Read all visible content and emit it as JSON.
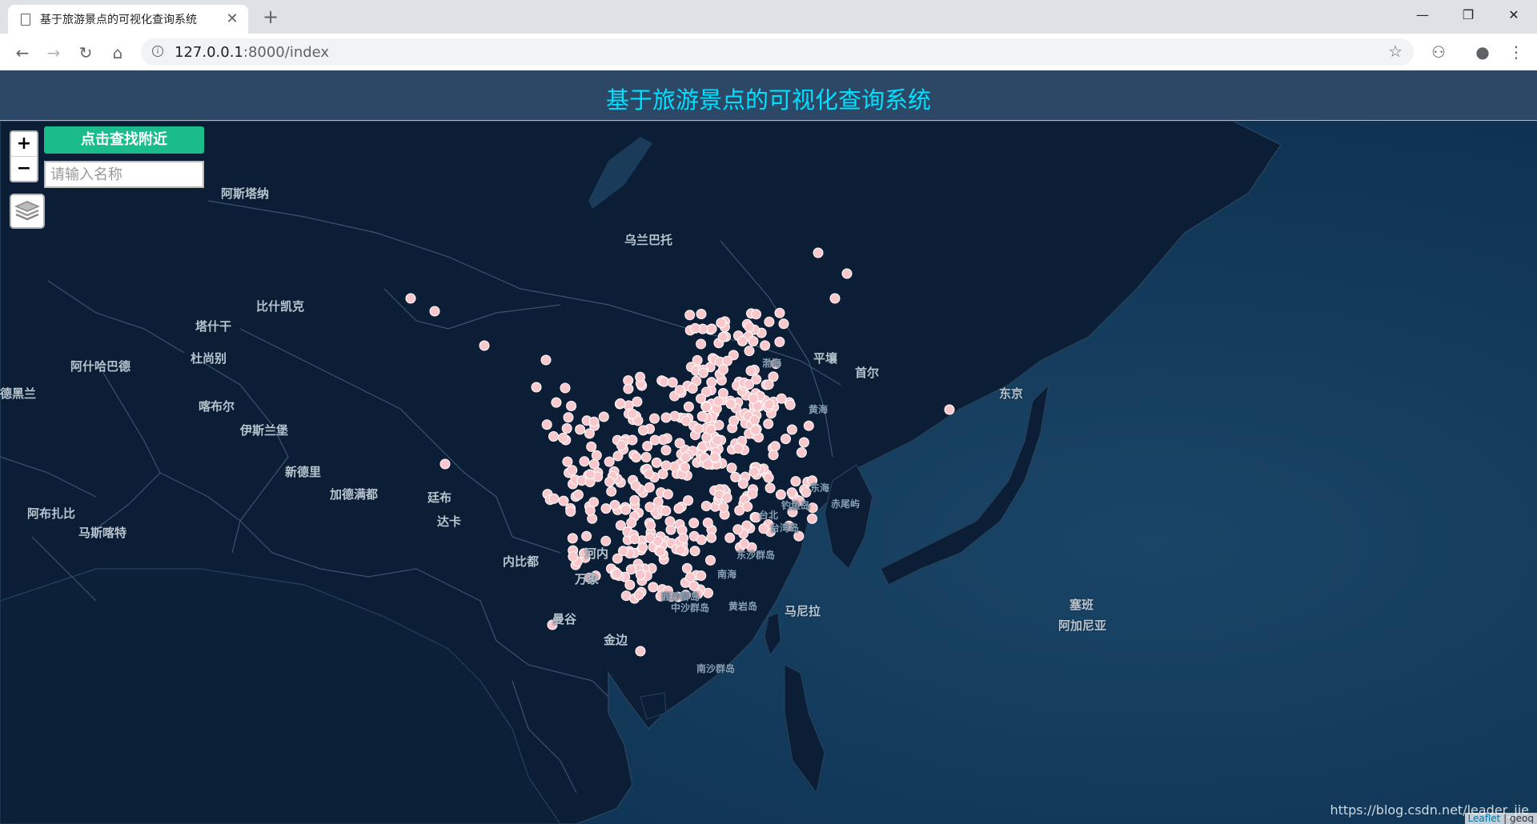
{
  "browser": {
    "tab_title": "基于旅游景点的可视化查询系统",
    "tab_close": "✕",
    "new_tab": "+",
    "url_host": "127.0.0.1",
    "url_rest": ":8000/index",
    "win_min": "—",
    "win_max": "❐",
    "win_close": "✕"
  },
  "page": {
    "title": "基于旅游景点的可视化查询系统"
  },
  "controls": {
    "zoom_in": "+",
    "zoom_out": "−",
    "nearby_button": "点击查找附近",
    "search_placeholder": "请输入名称"
  },
  "map_labels": [
    {
      "text": "阿斯塔纳"
    },
    {
      "text": "乌兰巴托"
    },
    {
      "text": "比什凯克"
    },
    {
      "text": "塔什干"
    },
    {
      "text": "杜尚别"
    },
    {
      "text": "阿什哈巴德"
    },
    {
      "text": "喀布尔"
    },
    {
      "text": "伊斯兰堡"
    },
    {
      "text": "新德里"
    },
    {
      "text": "加德满都"
    },
    {
      "text": "廷布"
    },
    {
      "text": "达卡"
    },
    {
      "text": "阿布扎比"
    },
    {
      "text": "马斯喀特"
    },
    {
      "text": "德黑兰"
    },
    {
      "text": "内比都"
    },
    {
      "text": "河内"
    },
    {
      "text": "万象"
    },
    {
      "text": "曼谷"
    },
    {
      "text": "金边"
    },
    {
      "text": "平壤"
    },
    {
      "text": "首尔"
    },
    {
      "text": "东京"
    },
    {
      "text": "渤海"
    },
    {
      "text": "黄海"
    },
    {
      "text": "东海"
    },
    {
      "text": "钓鱼岛"
    },
    {
      "text": "赤尾屿"
    },
    {
      "text": "台北"
    },
    {
      "text": "台湾岛"
    },
    {
      "text": "东沙群岛"
    },
    {
      "text": "南海"
    },
    {
      "text": "西沙群岛"
    },
    {
      "text": "中沙群岛"
    },
    {
      "text": "黄岩岛"
    },
    {
      "text": "马尼拉"
    },
    {
      "text": "南沙群岛"
    },
    {
      "text": "塞班"
    },
    {
      "text": "阿加尼亚"
    }
  ],
  "attribution": {
    "leaflet": "Leaflet",
    "provider": "geoq"
  },
  "watermark": "https://blog.csdn.net/leader_jie",
  "colors": {
    "header_bg": "#2c4866",
    "title_color": "#00e0ff",
    "button_bg": "#1abc8c",
    "map_bg": "#0a2540",
    "marker": "#f8c8cc"
  }
}
